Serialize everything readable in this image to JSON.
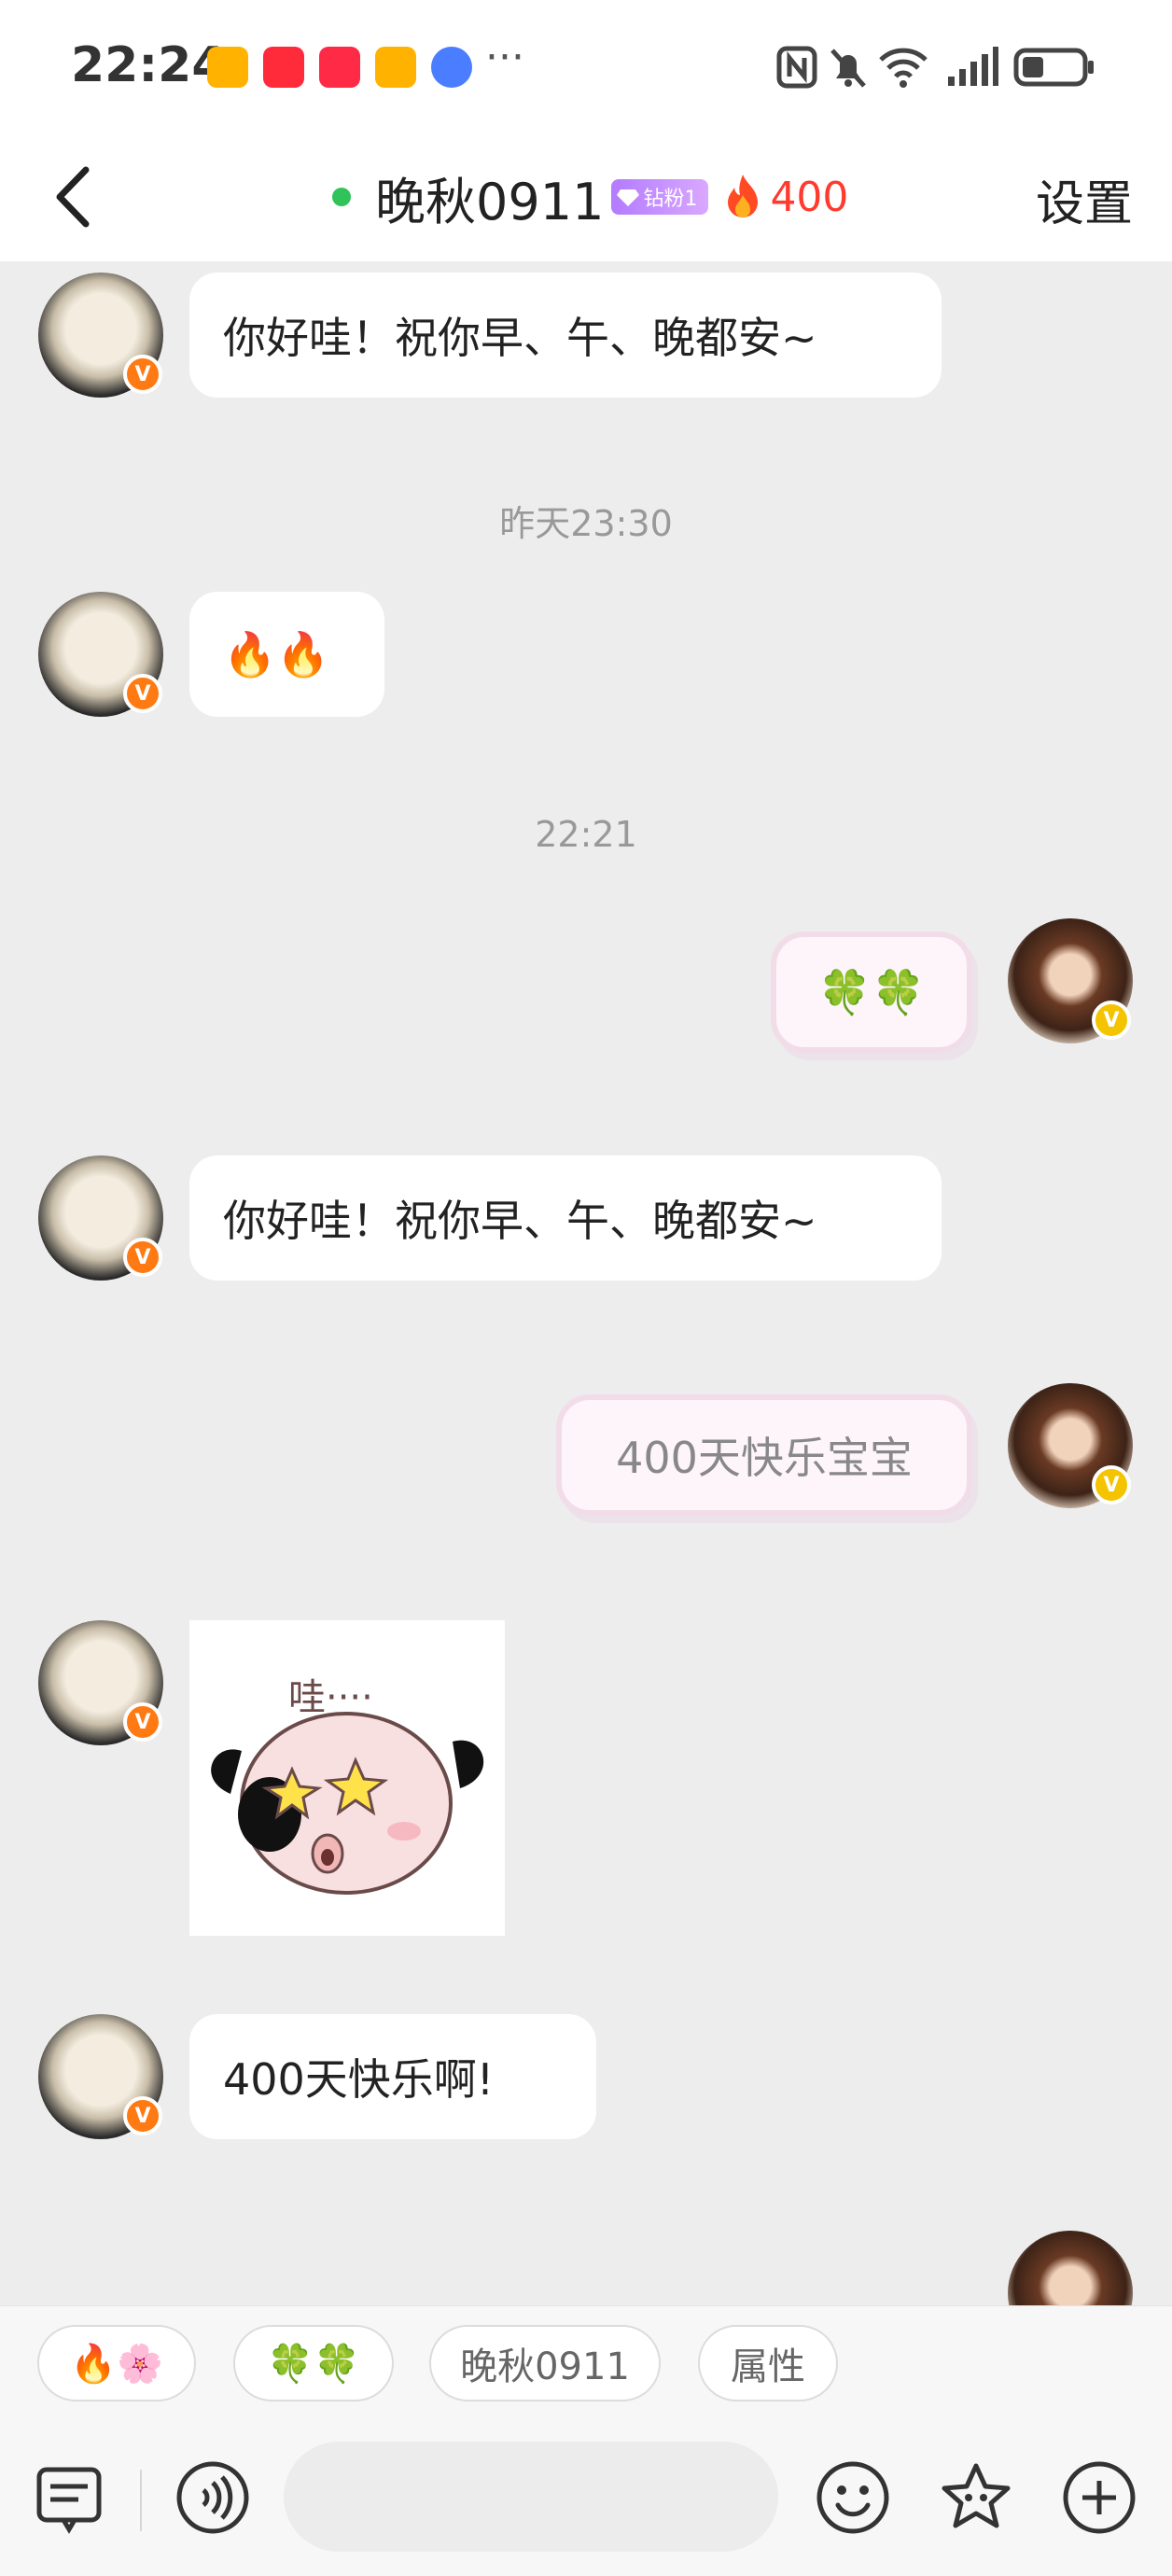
{
  "status_bar": {
    "time": "22:24",
    "more": "···",
    "app_icons": [
      "weibo-icon",
      "red-square-icon",
      "xiaohongshu-icon",
      "weibo-icon",
      "music-icon"
    ],
    "right_icons": [
      "nfc-icon",
      "mute-bell-icon",
      "wifi-icon",
      "signal-icon",
      "battery-icon"
    ]
  },
  "header": {
    "back_icon": "chevron-left-icon",
    "title": "晚秋0911",
    "badge": "钻粉1",
    "fire_count": "400",
    "settings": "设置"
  },
  "messages": {
    "m1": "你好哇！祝你早、午、晚都安~",
    "ts1": "昨天23:30",
    "m2": "🔥🔥",
    "ts2": "22:21",
    "m3": "🍀🍀",
    "m4": "你好哇！祝你早、午、晚都安~",
    "m5": "400天快乐宝宝",
    "m6_sticker_text": "哇····",
    "m7": "400天快乐啊!"
  },
  "quick_replies": [
    "🔥🌸",
    "🍀🍀",
    "晚秋0911",
    "属性"
  ],
  "input_bar": {
    "icons": [
      "keyboard-list-icon",
      "voice-icon",
      "emoji-icon",
      "star-sticker-icon",
      "plus-icon"
    ],
    "placeholder": ""
  },
  "colors": {
    "online": "#2fc35a",
    "fire": "#ff3a2e",
    "verified_orange": "#ff7a12",
    "verified_gold": "#f5c400",
    "chat_bg": "#ededed"
  }
}
